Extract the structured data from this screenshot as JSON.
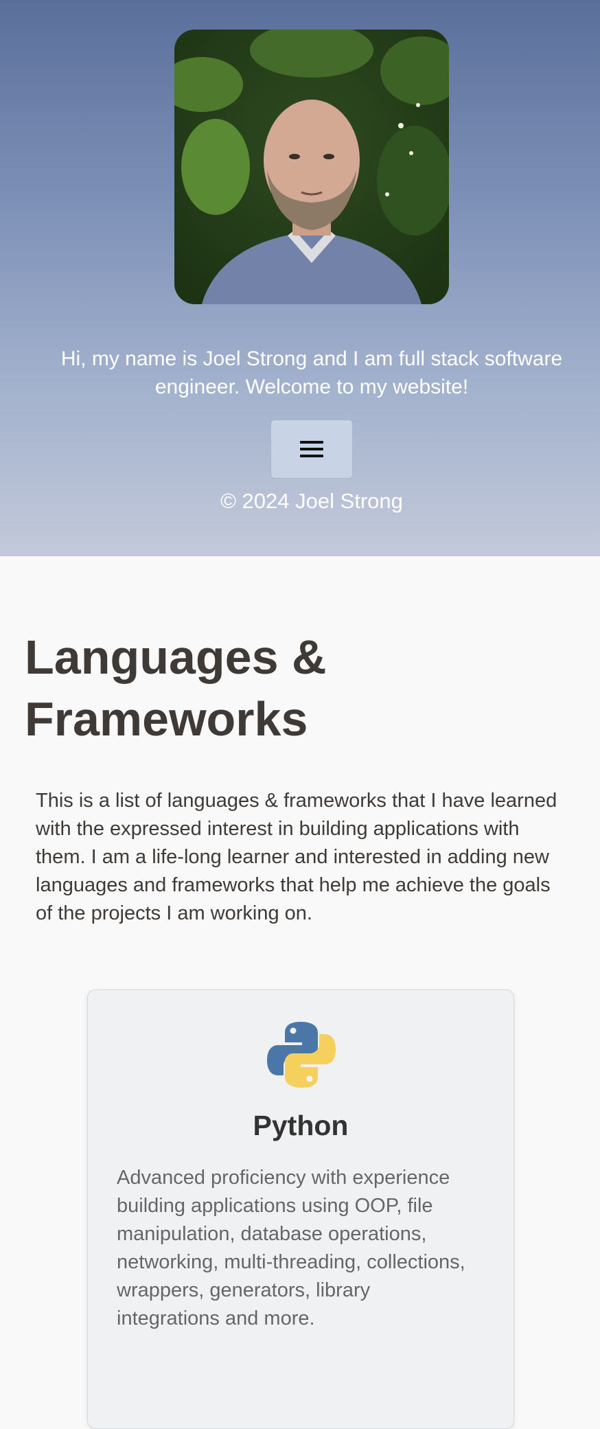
{
  "hero": {
    "intro": "Hi, my name is Joel Strong and I am full stack software engineer. Welcome to my website!",
    "menu_icon": "hamburger-menu-icon",
    "copyright": "© 2024 Joel Strong",
    "gradient_top": "#5a6f9a",
    "gradient_bottom": "#c3c9da"
  },
  "section": {
    "title": "Languages & Frameworks",
    "description": "This is a list of languages & frameworks that I have learned with the expressed interest in building applications with them. I am a life-long learner and interested in adding new languages and frameworks that help me achieve the goals of the projects I am working on."
  },
  "cards": [
    {
      "icon": "python-logo-icon",
      "name": "Python",
      "description": "Advanced proficiency with experience building applications using OOP, file manipulation, database operations, networking, multi-threading, collections, wrappers, generators, library integrations and more."
    }
  ],
  "colors": {
    "python_blue": "#4a77a8",
    "python_yellow": "#f5d05c",
    "heading_text": "#3f3a36"
  }
}
